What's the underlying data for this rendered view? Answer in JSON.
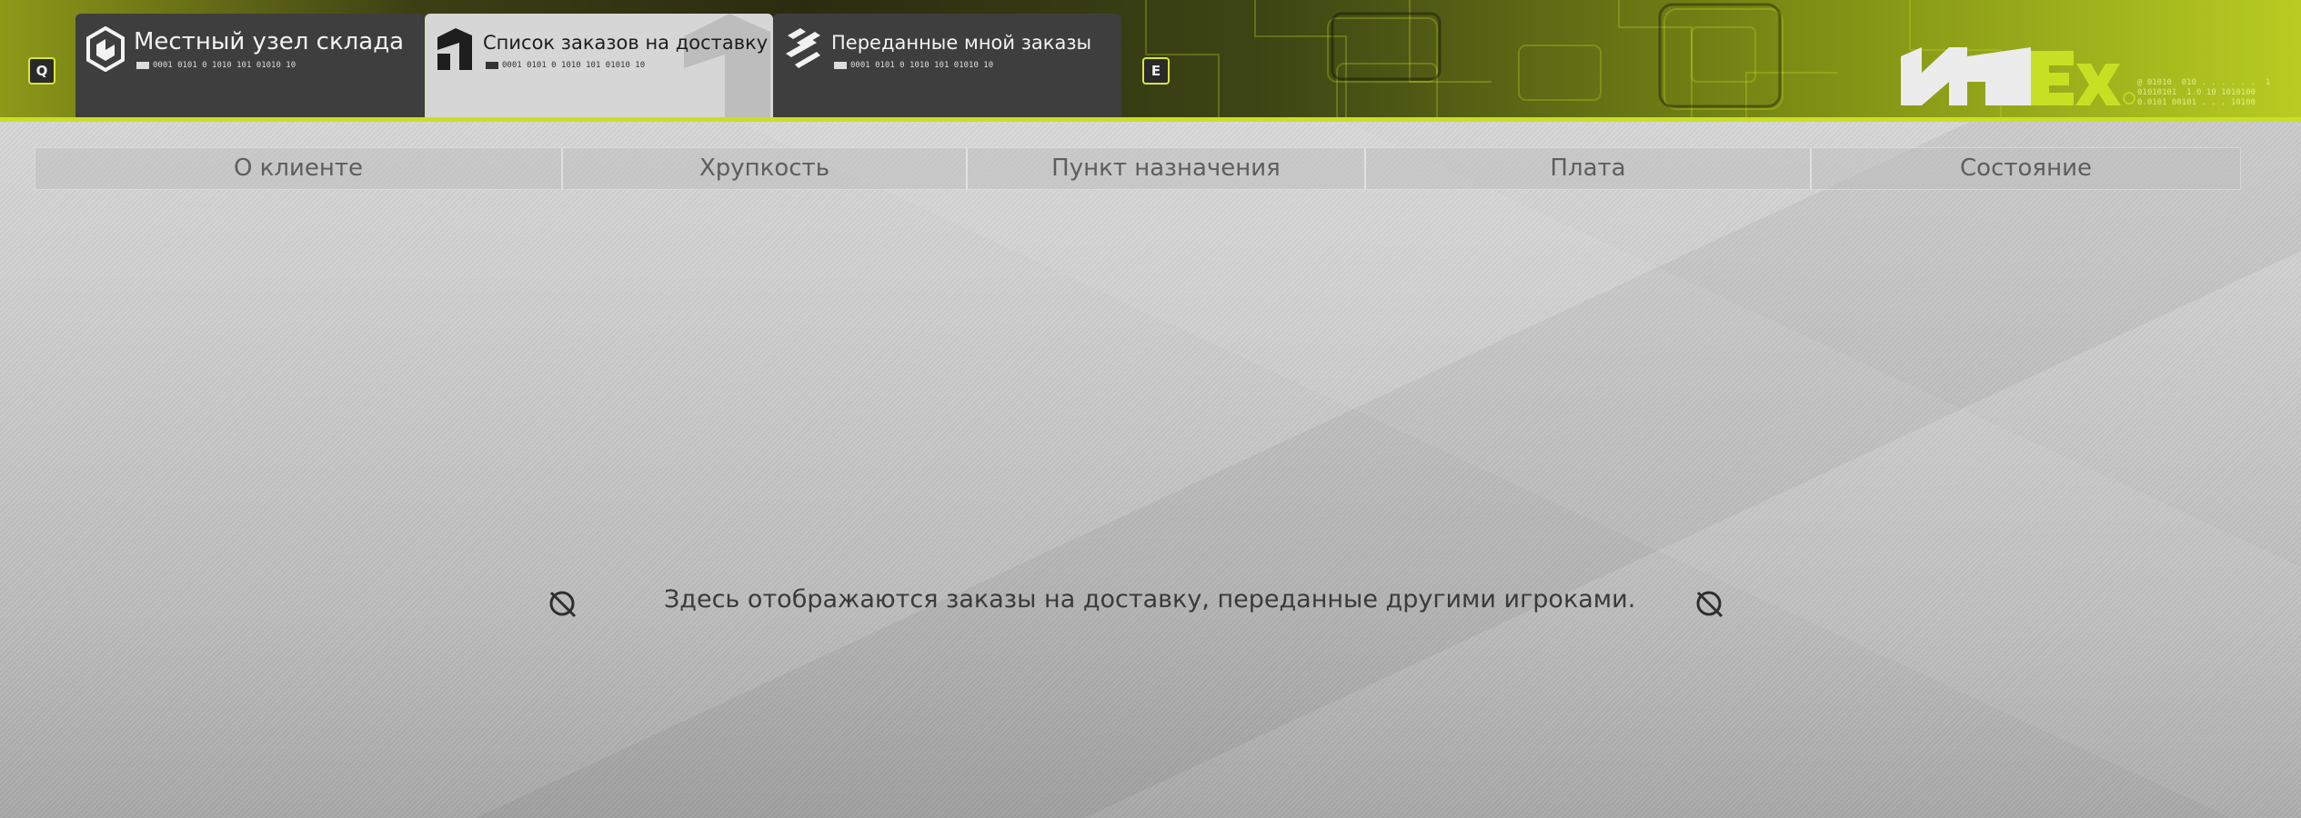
{
  "app": {
    "accent_color": "#c8e024",
    "topbar_color": "#2a2c10"
  },
  "key_hints": {
    "prev": "Q",
    "next": "E"
  },
  "tabs": [
    {
      "label": "Местный узел склада",
      "code": "0001  0101 0 1010 101 01010 10",
      "icon": "warehouse-cube-icon",
      "active": false
    },
    {
      "label": "Список заказов на доставку",
      "code": "0001  0101 0 1010 101 01010 10",
      "icon": "delivery-list-icon",
      "active": true
    },
    {
      "label": "Переданные мной заказы",
      "code": "0001  0101 0 1010 101 01010 10",
      "icon": "shared-orders-icon",
      "active": false
    }
  ],
  "logo": {
    "icon": "brand-logo-icon",
    "binary_text": "@ 01010  010 . . . . . .  1\n01010101  1.0 10 1010100\n0.0101 00101 . . . 10100"
  },
  "table": {
    "columns": [
      "О клиенте",
      "Хрупкость",
      "Пункт назначения",
      "Плата",
      "Состояние"
    ],
    "rows": []
  },
  "empty_state": {
    "message": "Здесь отображаются заказы на доставку, переданные другими игроками.",
    "icon": "no-entry-icon"
  }
}
